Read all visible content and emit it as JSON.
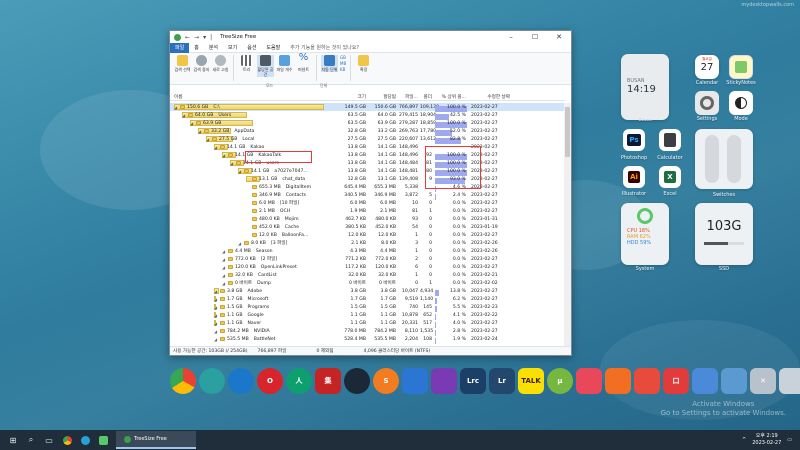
{
  "watermark": "mydesktopwalls.com",
  "desktop_watermark": [
    "Activate Windows",
    "Go to Settings to activate Windows."
  ],
  "window": {
    "title": "TreeSize Free",
    "menu": [
      "파일",
      "홈",
      "분석",
      "보기",
      "옵션",
      "도움말",
      "추가 기능을 원하는 것이 있나요?"
    ],
    "ribbon": [
      {
        "label": "검색\n선택",
        "icon": "scan-icon"
      },
      {
        "label": "검색\n중지",
        "icon": "stop-icon"
      },
      {
        "label": "새로\n고침",
        "icon": "refresh-icon"
      },
      {
        "label": "트리",
        "icon": "tree-icon"
      },
      {
        "label": "할당된\n공간",
        "icon": "allocated-icon"
      },
      {
        "label": "파일\n개수",
        "icon": "filecount-icon"
      },
      {
        "label": "퍼센트",
        "icon": "percent-icon"
      },
      {
        "label": "자동\n단위",
        "icon": "auto-unit-icon"
      },
      {
        "label": "확장",
        "icon": "expand-icon"
      }
    ],
    "ribbon_groups": [
      "모드",
      "단위"
    ],
    "unit_buttons": [
      "GB",
      "MB",
      "KB"
    ],
    "columns": [
      "이름",
      "크기",
      "할당됨",
      "파일...",
      "폴더",
      "% 상위 폴...",
      "수정한 날짜"
    ],
    "rows": [
      {
        "indent": 0,
        "size": "150.6 GB",
        "name": "C:\\",
        "c1": "149.5 GB",
        "c2": "150.6 GB",
        "c3": "766,897",
        "c4": "109,139",
        "pct": 100.0,
        "pct_label": "100.0 %",
        "date": "2023-02-27",
        "bar": 1.0,
        "sel": true
      },
      {
        "indent": 1,
        "size": "64.0 GB",
        "name": "Users",
        "c1": "63.5 GB",
        "c2": "64.0 GB",
        "c3": "279,415",
        "c4": "18,904",
        "pct": 42.5,
        "pct_label": "42.5 %",
        "date": "2023-02-27",
        "bar": 0.43
      },
      {
        "indent": 2,
        "size": "63.9 GB",
        "name": "",
        "c1": "63.5 GB",
        "c2": "63.9 GB",
        "c3": "279,287",
        "c4": "18,859",
        "pct": 100.0,
        "pct_label": "100.0 %",
        "date": "2023-02-27",
        "bar": 0.42
      },
      {
        "indent": 3,
        "size": "33.2 GB",
        "name": "AppData",
        "c1": "32.8 GB",
        "c2": "33.2 GB",
        "c3": "269,763",
        "c4": "17,780",
        "pct": 52.0,
        "pct_label": "52.0 %",
        "date": "2023-02-27",
        "bar": 0.22
      },
      {
        "indent": 4,
        "size": "27.5 GB",
        "name": "Local",
        "c1": "27.5 GB",
        "c2": "27.5 GB",
        "c3": "220,607",
        "c4": "13,612",
        "pct": 82.8,
        "pct_label": "82.8 %",
        "date": "2023-02-27",
        "bar": 0.18
      },
      {
        "indent": 5,
        "size": "14.1 GB",
        "name": "Kakao",
        "c1": "13.8 GB",
        "c2": "14.1 GB",
        "c3": "148,496",
        "c4": "",
        "pct": 0,
        "pct_label": "",
        "date": "2023-02-27",
        "bar": 0.09
      },
      {
        "indent": 6,
        "size": "14.1 GB",
        "name": "KakaoTalk",
        "c1": "13.8 GB",
        "c2": "14.1 GB",
        "c3": "148,496",
        "c4": "92",
        "pct": 100.0,
        "pct_label": "100.0 %",
        "date": "2023-02-27",
        "bar": 0.09
      },
      {
        "indent": 7,
        "size": "14.1 GB",
        "name": "users",
        "c1": "13.8 GB",
        "c2": "14.1 GB",
        "c3": "148,484",
        "c4": "81",
        "pct": 100.0,
        "pct_label": "100.0 %",
        "date": "2023-02-27",
        "bar": 0.09
      },
      {
        "indent": 8,
        "size": "14.1 GB",
        "name": "a7027e7047...",
        "c1": "13.8 GB",
        "c2": "14.1 GB",
        "c3": "148,481",
        "c4": "80",
        "pct": 100.0,
        "pct_label": "100.0 %",
        "date": "2023-02-27",
        "bar": 0.09
      },
      {
        "indent": 9,
        "size": "13.1 GB",
        "name": "chat_data",
        "c1": "12.8 GB",
        "c2": "13.1 GB",
        "c3": "139,408",
        "c4": "9",
        "pct": 93.0,
        "pct_label": "93.0 %",
        "date": "2023-02-27",
        "bar": 0.09
      },
      {
        "indent": 9,
        "size": "655.3 MB",
        "name": "DigitalItem",
        "c1": "645.4 MB",
        "c2": "655.3 MB",
        "c3": "5,338",
        "c4": "",
        "pct": 4.6,
        "pct_label": "4.6 %",
        "date": "2023-02-27",
        "bar": 0
      },
      {
        "indent": 9,
        "size": "346.9 MB",
        "name": "Contacts",
        "c1": "340.5 MB",
        "c2": "346.9 MB",
        "c3": "3,872",
        "c4": "5",
        "pct": 2.4,
        "pct_label": "2.4 %",
        "date": "2023-02-27",
        "bar": 0
      },
      {
        "indent": 9,
        "size": "6.0 MB",
        "name": "[10 파일]",
        "c1": "6.0 MB",
        "c2": "6.0 MB",
        "c3": "10",
        "c4": "0",
        "pct": 0.0,
        "pct_label": "0.0 %",
        "date": "2023-02-27",
        "bar": 0
      },
      {
        "indent": 9,
        "size": "2.1 MB",
        "name": "OCH",
        "c1": "1.9 MB",
        "c2": "2.1 MB",
        "c3": "81",
        "c4": "1",
        "pct": 0.0,
        "pct_label": "0.0 %",
        "date": "2023-02-27",
        "bar": 0
      },
      {
        "indent": 9,
        "size": "480.0 KB",
        "name": "Mojim",
        "c1": "462.7 KB",
        "c2": "480.0 KB",
        "c3": "93",
        "c4": "0",
        "pct": 0.0,
        "pct_label": "0.0 %",
        "date": "2023-01-31",
        "bar": 0
      },
      {
        "indent": 9,
        "size": "452.0 KB",
        "name": "Cache",
        "c1": "380.5 KB",
        "c2": "452.0 KB",
        "c3": "54",
        "c4": "0",
        "pct": 0.0,
        "pct_label": "0.0 %",
        "date": "2023-01-19",
        "bar": 0
      },
      {
        "indent": 9,
        "size": "12.0 KB",
        "name": "BalloonFa...",
        "c1": "12.0 KB",
        "c2": "12.0 KB",
        "c3": "1",
        "c4": "0",
        "pct": 0.0,
        "pct_label": "0.0 %",
        "date": "2023-02-27",
        "bar": 0
      },
      {
        "indent": 8,
        "size": "8.0 KB",
        "name": "[3 파일]",
        "c1": "2.1 KB",
        "c2": "8.0 KB",
        "c3": "3",
        "c4": "0",
        "pct": 0.0,
        "pct_label": "0.0 %",
        "date": "2023-02-26",
        "bar": 0
      },
      {
        "indent": 6,
        "size": "4.4 MB",
        "name": "Season",
        "c1": "4.3 MB",
        "c2": "4.4 MB",
        "c3": "1",
        "c4": "0",
        "pct": 0.0,
        "pct_label": "0.0 %",
        "date": "2023-02-26",
        "bar": 0
      },
      {
        "indent": 6,
        "size": "772.0 KB",
        "name": "[2 파일]",
        "c1": "771.2 KB",
        "c2": "772.0 KB",
        "c3": "2",
        "c4": "0",
        "pct": 0.0,
        "pct_label": "0.0 %",
        "date": "2023-02-27",
        "bar": 0
      },
      {
        "indent": 6,
        "size": "120.0 KB",
        "name": "OpenLinkPreset",
        "c1": "117.2 KB",
        "c2": "120.0 KB",
        "c3": "6",
        "c4": "0",
        "pct": 0.0,
        "pct_label": "0.0 %",
        "date": "2023-02-27",
        "bar": 0
      },
      {
        "indent": 6,
        "size": "32.0 KB",
        "name": "CardList",
        "c1": "32.0 KB",
        "c2": "32.0 KB",
        "c3": "1",
        "c4": "0",
        "pct": 0.0,
        "pct_label": "0.0 %",
        "date": "2023-02-21",
        "bar": 0
      },
      {
        "indent": 6,
        "size": "0 바이트",
        "name": "Dump",
        "c1": "0 바이트",
        "c2": "0 바이트",
        "c3": "0",
        "c4": "1",
        "pct": 0.0,
        "pct_label": "0.0 %",
        "date": "2023-02-02",
        "bar": 0
      },
      {
        "indent": 5,
        "size": "3.8 GB",
        "name": "Adobe",
        "c1": "3.8 GB",
        "c2": "3.8 GB",
        "c3": "10,047",
        "c4": "4,934",
        "pct": 13.8,
        "pct_label": "13.8 %",
        "date": "2023-02-27",
        "bar": 0.03
      },
      {
        "indent": 5,
        "size": "1.7 GB",
        "name": "Microsoft",
        "c1": "1.7 GB",
        "c2": "1.7 GB",
        "c3": "9,519",
        "c4": "1,140",
        "pct": 6.2,
        "pct_label": "6.2 %",
        "date": "2023-02-27",
        "bar": 0.01
      },
      {
        "indent": 5,
        "size": "1.5 GB",
        "name": "Programs",
        "c1": "1.5 GB",
        "c2": "1.5 GB",
        "c3": "740",
        "c4": "145",
        "pct": 5.5,
        "pct_label": "5.5 %",
        "date": "2023-02-23",
        "bar": 0.01
      },
      {
        "indent": 5,
        "size": "1.1 GB",
        "name": "Google",
        "c1": "1.1 GB",
        "c2": "1.1 GB",
        "c3": "10,878",
        "c4": "652",
        "pct": 4.1,
        "pct_label": "4.1 %",
        "date": "2023-02-22",
        "bar": 0.01
      },
      {
        "indent": 5,
        "size": "1.1 GB",
        "name": "Naver",
        "c1": "1.1 GB",
        "c2": "1.1 GB",
        "c3": "20,331",
        "c4": "517",
        "pct": 4.0,
        "pct_label": "4.0 %",
        "date": "2023-02-27",
        "bar": 0.01
      },
      {
        "indent": 5,
        "size": "784.2 MB",
        "name": "NVIDIA",
        "c1": "778.0 MB",
        "c2": "784.2 MB",
        "c3": "8,110",
        "c4": "1,535",
        "pct": 2.8,
        "pct_label": "2.8 %",
        "date": "2023-02-27",
        "bar": 0
      },
      {
        "indent": 5,
        "size": "535.5 MB",
        "name": "BattleNet",
        "c1": "528.4 MB",
        "c2": "535.5 MB",
        "c3": "2,204",
        "c4": "108",
        "pct": 1.9,
        "pct_label": "1.9 %",
        "date": "2023-02-24",
        "bar": 0
      }
    ],
    "status": {
      "free": "사용 가능한 공간: 103GB (/ 254GB)",
      "files": "766,897 파일",
      "errors": "0 제외됨",
      "cluster": "4,096 클러스터당 바이트 (NTFS)"
    }
  },
  "widgets": {
    "clock": {
      "city": "BUSAN",
      "time": "14:19",
      "label": "Clock"
    },
    "calendar": {
      "weekday": "월요일",
      "day": "27",
      "label": "Calendar"
    },
    "sticky": {
      "label": "StickyNotes"
    },
    "settings": {
      "label": "Settings"
    },
    "mode": {
      "label": "Mode"
    },
    "photoshop": {
      "label": "Photoshop",
      "text": "Ps"
    },
    "calculator": {
      "label": "Calculator"
    },
    "illustrator": {
      "label": "Illustrator",
      "text": "Ai"
    },
    "excel": {
      "label": "Excel"
    },
    "switches": {
      "label": "Switches"
    },
    "system": {
      "cpu": "CPU 18%",
      "ram": "RAM 62%",
      "hdd": "HDD 59%",
      "label": "System"
    },
    "ssd": {
      "value": "103G",
      "label": "SSD"
    }
  },
  "dock": [
    {
      "name": "chrome",
      "text": "",
      "color": "#e8e8e8"
    },
    {
      "name": "edge-dev",
      "text": "",
      "color": "#2aa0a0"
    },
    {
      "name": "edge",
      "text": "",
      "color": "#1b77c9"
    },
    {
      "name": "opera",
      "text": "O",
      "color": "#d8242b"
    },
    {
      "name": "naver-whale",
      "text": "人",
      "color": "#0e9f6e"
    },
    {
      "name": "app-red",
      "text": "集",
      "color": "#c62424"
    },
    {
      "name": "steam",
      "text": "",
      "color": "#1b2838"
    },
    {
      "name": "s-app",
      "text": "S",
      "color": "#f47c20"
    },
    {
      "name": "bluetooth",
      "text": "",
      "color": "#2b76d2"
    },
    {
      "name": "cpu",
      "text": "",
      "color": "#7a3ab3"
    },
    {
      "name": "lightroom-classic",
      "text": "Lrc",
      "color": "#1b3f66"
    },
    {
      "name": "lightroom",
      "text": "Lr",
      "color": "#24476e"
    },
    {
      "name": "kakaotalk",
      "text": "TALK",
      "color": "#f9e000"
    },
    {
      "name": "utorrent",
      "text": "μ",
      "color": "#76b83f"
    },
    {
      "name": "camera",
      "text": "",
      "color": "#e8485a"
    },
    {
      "name": "app-orange",
      "text": "",
      "color": "#f26e22"
    },
    {
      "name": "app-red2",
      "text": "",
      "color": "#e84a3c"
    },
    {
      "name": "crop",
      "text": "口",
      "color": "#e23b3b"
    },
    {
      "name": "app-blue",
      "text": "",
      "color": "#4a8ad8"
    },
    {
      "name": "app-map",
      "text": "",
      "color": "#5a9ad0"
    },
    {
      "name": "tools",
      "text": "✕",
      "color": "#b8c2cc"
    },
    {
      "name": "trash",
      "text": "",
      "color": "#c9d2da"
    }
  ],
  "taskbar": {
    "active_app": "TreeSize Free",
    "time": "오후 2:19",
    "date": "2023-02-27"
  }
}
